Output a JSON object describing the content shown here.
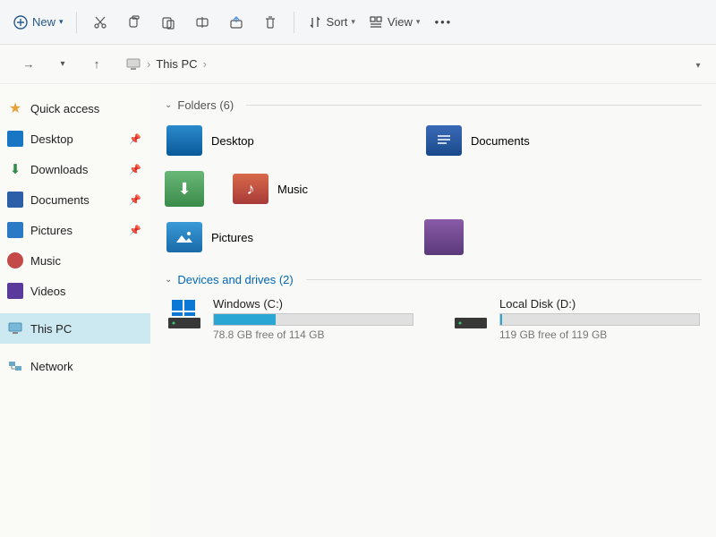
{
  "toolbar": {
    "new_label": "New",
    "sort_label": "Sort",
    "view_label": "View"
  },
  "breadcrumb": {
    "location": "This PC"
  },
  "sidebar": {
    "items": [
      {
        "label": "Quick access"
      },
      {
        "label": "Desktop"
      },
      {
        "label": "Downloads"
      },
      {
        "label": "Documents"
      },
      {
        "label": "Pictures"
      },
      {
        "label": "Music"
      },
      {
        "label": "Videos"
      },
      {
        "label": "This PC"
      },
      {
        "label": "Network"
      }
    ]
  },
  "sections": {
    "folders": {
      "title": "Folders (6)",
      "items": [
        {
          "label": "Desktop"
        },
        {
          "label": "Documents"
        },
        {
          "label": "Music"
        },
        {
          "label": "Pictures"
        }
      ]
    },
    "drives": {
      "title": "Devices and drives (2)",
      "items": [
        {
          "name": "Windows (C:)",
          "free": "78.8 GB free of 114 GB",
          "fill_pct": 31
        },
        {
          "name": "Local Disk (D:)",
          "free": "119 GB free of 119 GB",
          "fill_pct": 1
        }
      ]
    }
  }
}
